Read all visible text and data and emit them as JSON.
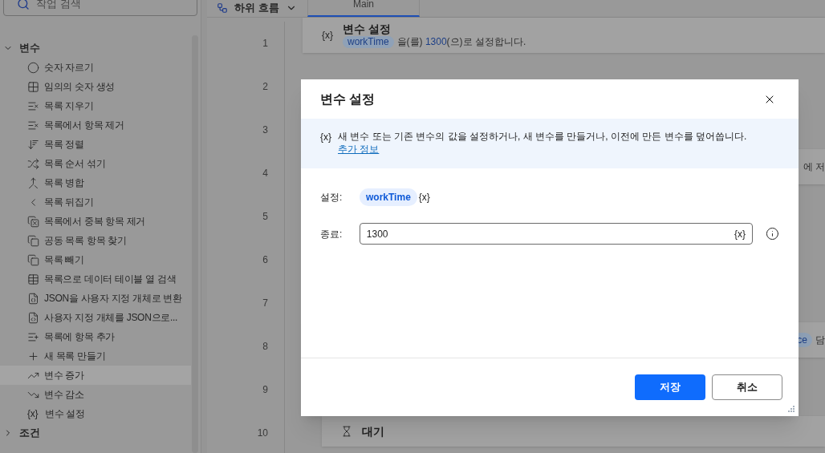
{
  "sidebar": {
    "search": {
      "placeholder": "작업 검색"
    },
    "tree": [
      {
        "label": "변수",
        "expanded": true,
        "children": [
          {
            "label": "숫자 자르기",
            "selected": false
          },
          {
            "label": "임의의 숫자 생성",
            "selected": false
          },
          {
            "label": "목록 지우기",
            "selected": false
          },
          {
            "label": "목록에서 항목 제거",
            "selected": false
          },
          {
            "label": "목록 정렬",
            "selected": false
          },
          {
            "label": "목록 순서 섞기",
            "selected": false
          },
          {
            "label": "목록 병합",
            "selected": false
          },
          {
            "label": "목록 뒤집기",
            "selected": false
          },
          {
            "label": "목록에서 중복 항목 제거",
            "selected": false
          },
          {
            "label": "공동 목록 항목 찾기",
            "selected": false
          },
          {
            "label": "목록 빼기",
            "selected": false
          },
          {
            "label": "목록으로 데이터 테이블 열 검색",
            "selected": false
          },
          {
            "label": "JSON을 사용자 지정 개체로 변환",
            "selected": false
          },
          {
            "label": "사용자 지정 개체를 JSON으로...",
            "selected": false
          },
          {
            "label": "목록에 항목 추가",
            "selected": false
          },
          {
            "label": "새 목록 만들기",
            "selected": false
          },
          {
            "label": "변수 증가",
            "selected": true
          },
          {
            "label": "변수 감소",
            "selected": false
          },
          {
            "label": "변수 설정",
            "selected": false,
            "glyph": "{x}"
          }
        ]
      },
      {
        "label": "조건",
        "expanded": false
      }
    ]
  },
  "toolbar": {
    "subflows": "하위 흐름"
  },
  "tabs": [
    {
      "label": "Main",
      "selected": true
    }
  ],
  "steps": [
    {
      "number": "1",
      "kind": "action",
      "glyph": "{x}",
      "title": "변수 설정",
      "variable": "workTime",
      "middle": "을(를) ",
      "value": "1300",
      "end": "(으)로 설정합니다."
    },
    {
      "number": "2",
      "kind": "hidden"
    },
    {
      "number": "3",
      "kind": "hidden"
    },
    {
      "number": "4",
      "kind": "fragment",
      "text": "에 저"
    },
    {
      "number": "5",
      "kind": "hidden"
    },
    {
      "number": "6",
      "kind": "hidden"
    },
    {
      "number": "7",
      "kind": "hidden"
    },
    {
      "number": "8",
      "kind": "chip-fragment",
      "chip": "ce",
      "text": "담"
    },
    {
      "number": "9",
      "kind": "hidden"
    },
    {
      "number": "10",
      "kind": "wait",
      "title": "대기"
    }
  ],
  "dialog": {
    "title": "변수 설정",
    "info_glyph": "{x}",
    "info": "새 변수 또는 기존 변수의 값을 설정하거나, 새 변수를 만들거나, 이전에 만든 변수를 덮어씁니다.",
    "link": "추가 정보",
    "set_label": "설정:",
    "set_variable": "workTime",
    "set_glyph": "{x}",
    "to_label": "종료:",
    "to_value": "1300",
    "to_glyph": "{x}",
    "buttons": [
      {
        "label": "저장",
        "kind": "primary"
      },
      {
        "label": "취소",
        "kind": "secondary"
      }
    ]
  }
}
